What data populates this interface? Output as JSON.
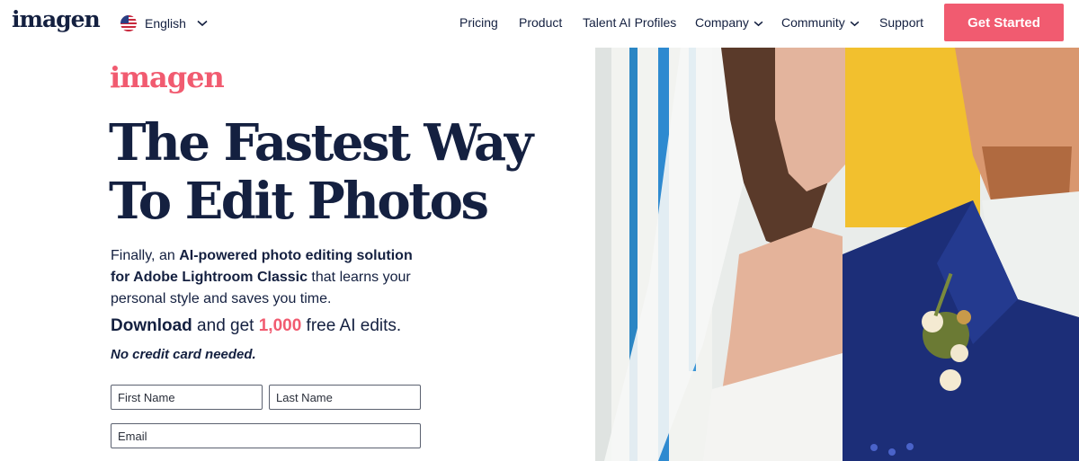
{
  "nav": {
    "logo": "imagen",
    "language": "English",
    "items": [
      {
        "label": "Pricing",
        "dropdown": false
      },
      {
        "label": "Product",
        "dropdown": false
      },
      {
        "label": "Talent AI Profiles",
        "dropdown": false
      },
      {
        "label": "Company",
        "dropdown": true
      },
      {
        "label": "Community",
        "dropdown": true
      },
      {
        "label": "Support",
        "dropdown": false
      }
    ],
    "cta": "Get Started"
  },
  "hero": {
    "brand": "imagen",
    "headline_line1": "The Fastest Way",
    "headline_line2": "To Edit Photos",
    "desc_1": "Finally, an ",
    "desc_2": "AI-powered photo editing solution for Adobe Lightroom Classic",
    "desc_3": " that learns your personal style and saves you time.",
    "offer_1": "Download",
    "offer_2": " and get ",
    "offer_3": "1,000",
    "offer_4": " free AI edits.",
    "no_card": "No credit card needed."
  },
  "form": {
    "first_name_placeholder": "First Name",
    "last_name_placeholder": "Last Name",
    "email_placeholder": "Email"
  },
  "colors": {
    "accent": "#f15b70",
    "navy": "#142040"
  },
  "icons": {
    "language_flag": "us-flag-icon",
    "dropdown": "chevron-down-icon"
  }
}
